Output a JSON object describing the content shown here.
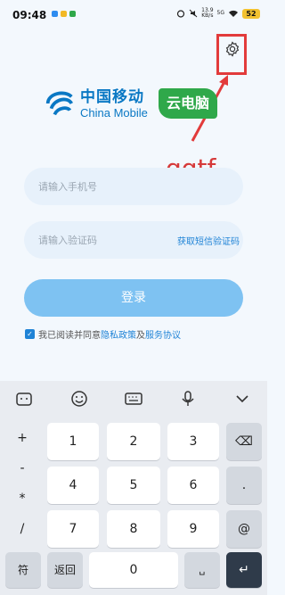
{
  "status_bar": {
    "time": "09:48",
    "net_speed_top": "13.9",
    "net_speed_bottom": "KB/s",
    "network": "5G",
    "battery": "52"
  },
  "logo": {
    "brand_cn": "中国移动",
    "brand_en": "China Mobile",
    "product": "云电脑"
  },
  "annotation": {
    "text": "qqtf",
    "color": "#d63a3a"
  },
  "login": {
    "phone_placeholder": "请输入手机号",
    "code_placeholder": "请输入验证码",
    "get_code_label": "获取短信验证码",
    "submit_label": "登录",
    "agreement_prefix": "我已阅读并同意",
    "privacy_link": "隐私政策",
    "conjunction": "及",
    "service_link": "服务协议"
  },
  "keyboard": {
    "toolbar_icons": [
      "keyboard-style-icon",
      "emoji-icon",
      "keyboard-icon",
      "microphone-icon",
      "chevron-down-icon"
    ],
    "side_symbols": [
      "+",
      "-",
      "*",
      "/"
    ],
    "digits": [
      "1",
      "2",
      "3",
      "4",
      "5",
      "6",
      "7",
      "8",
      "9"
    ],
    "right_keys": [
      "⌫",
      ".",
      "@"
    ],
    "bottom": {
      "symbols": "符",
      "back": "返回",
      "zero": "0",
      "space": "␣",
      "enter": "↵"
    }
  },
  "colors": {
    "accent": "#1f83d6",
    "brand": "#0a78c4",
    "cloud_green": "#2fa84a",
    "highlight_red": "#e23b3b"
  }
}
